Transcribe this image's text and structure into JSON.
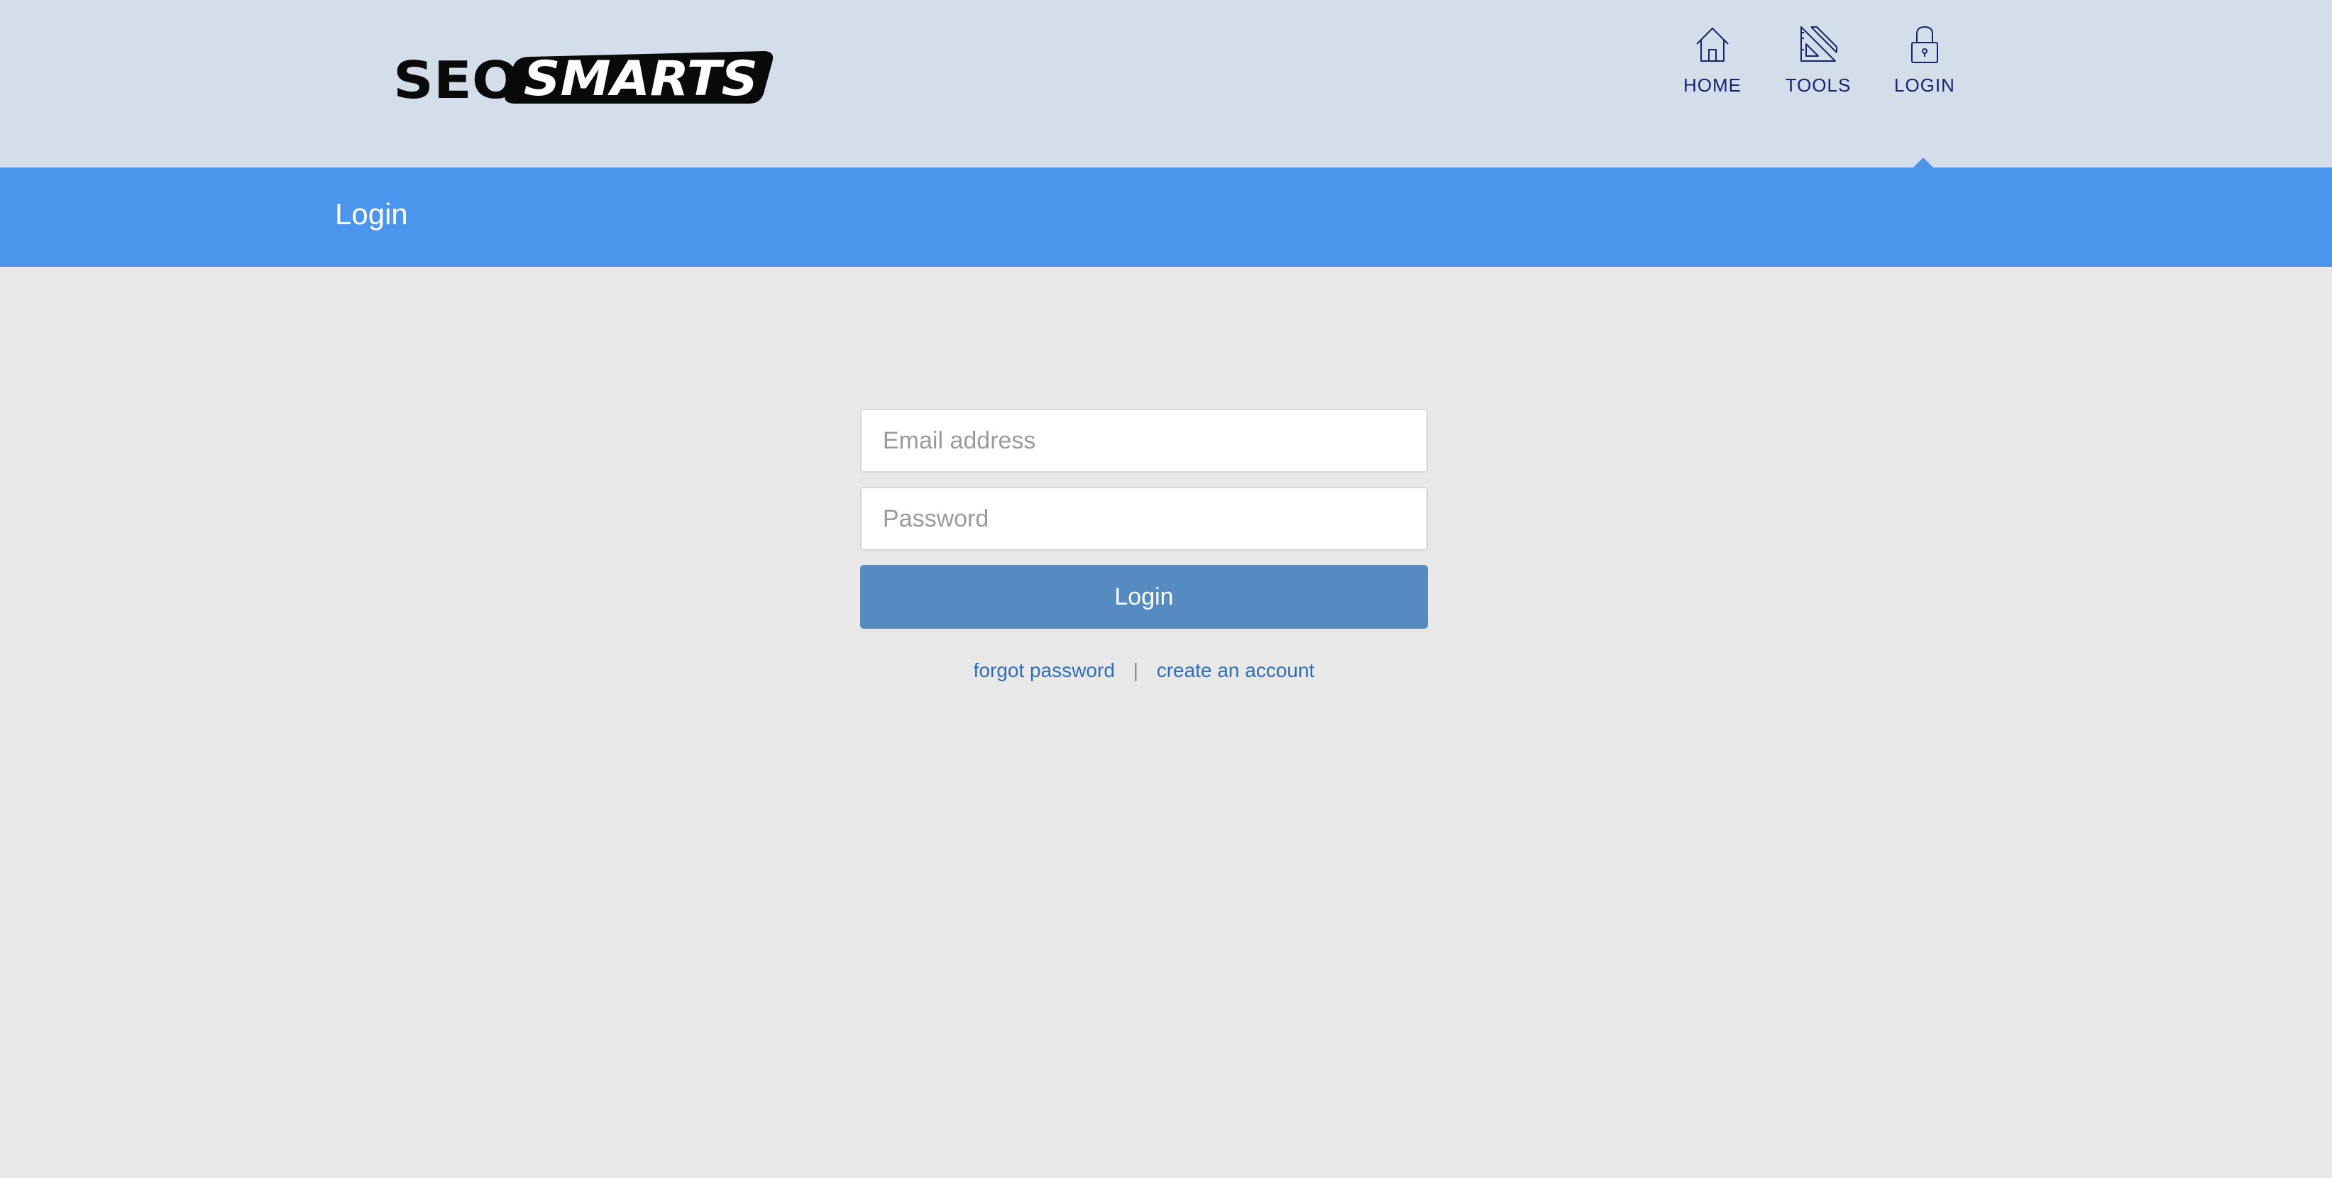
{
  "header": {
    "logo_text": "SEO SMARTS",
    "nav": [
      {
        "label": "HOME",
        "icon": "home-icon"
      },
      {
        "label": "TOOLS",
        "icon": "ruler-triangle-icon"
      },
      {
        "label": "LOGIN",
        "icon": "lock-icon"
      }
    ],
    "active_nav": "LOGIN"
  },
  "title_bar": {
    "title": "Login"
  },
  "login_form": {
    "email_placeholder": "Email address",
    "email_value": "",
    "password_placeholder": "Password",
    "password_value": "",
    "submit_label": "Login",
    "forgot_label": "forgot password",
    "separator": "|",
    "create_label": "create an account"
  },
  "colors": {
    "header_bg": "#d4deea",
    "title_bar_bg": "#4b95ec",
    "page_bg": "#e8e8e9",
    "button_bg": "#558bc0",
    "link": "#2f6db5",
    "nav_text": "#1a2170"
  }
}
